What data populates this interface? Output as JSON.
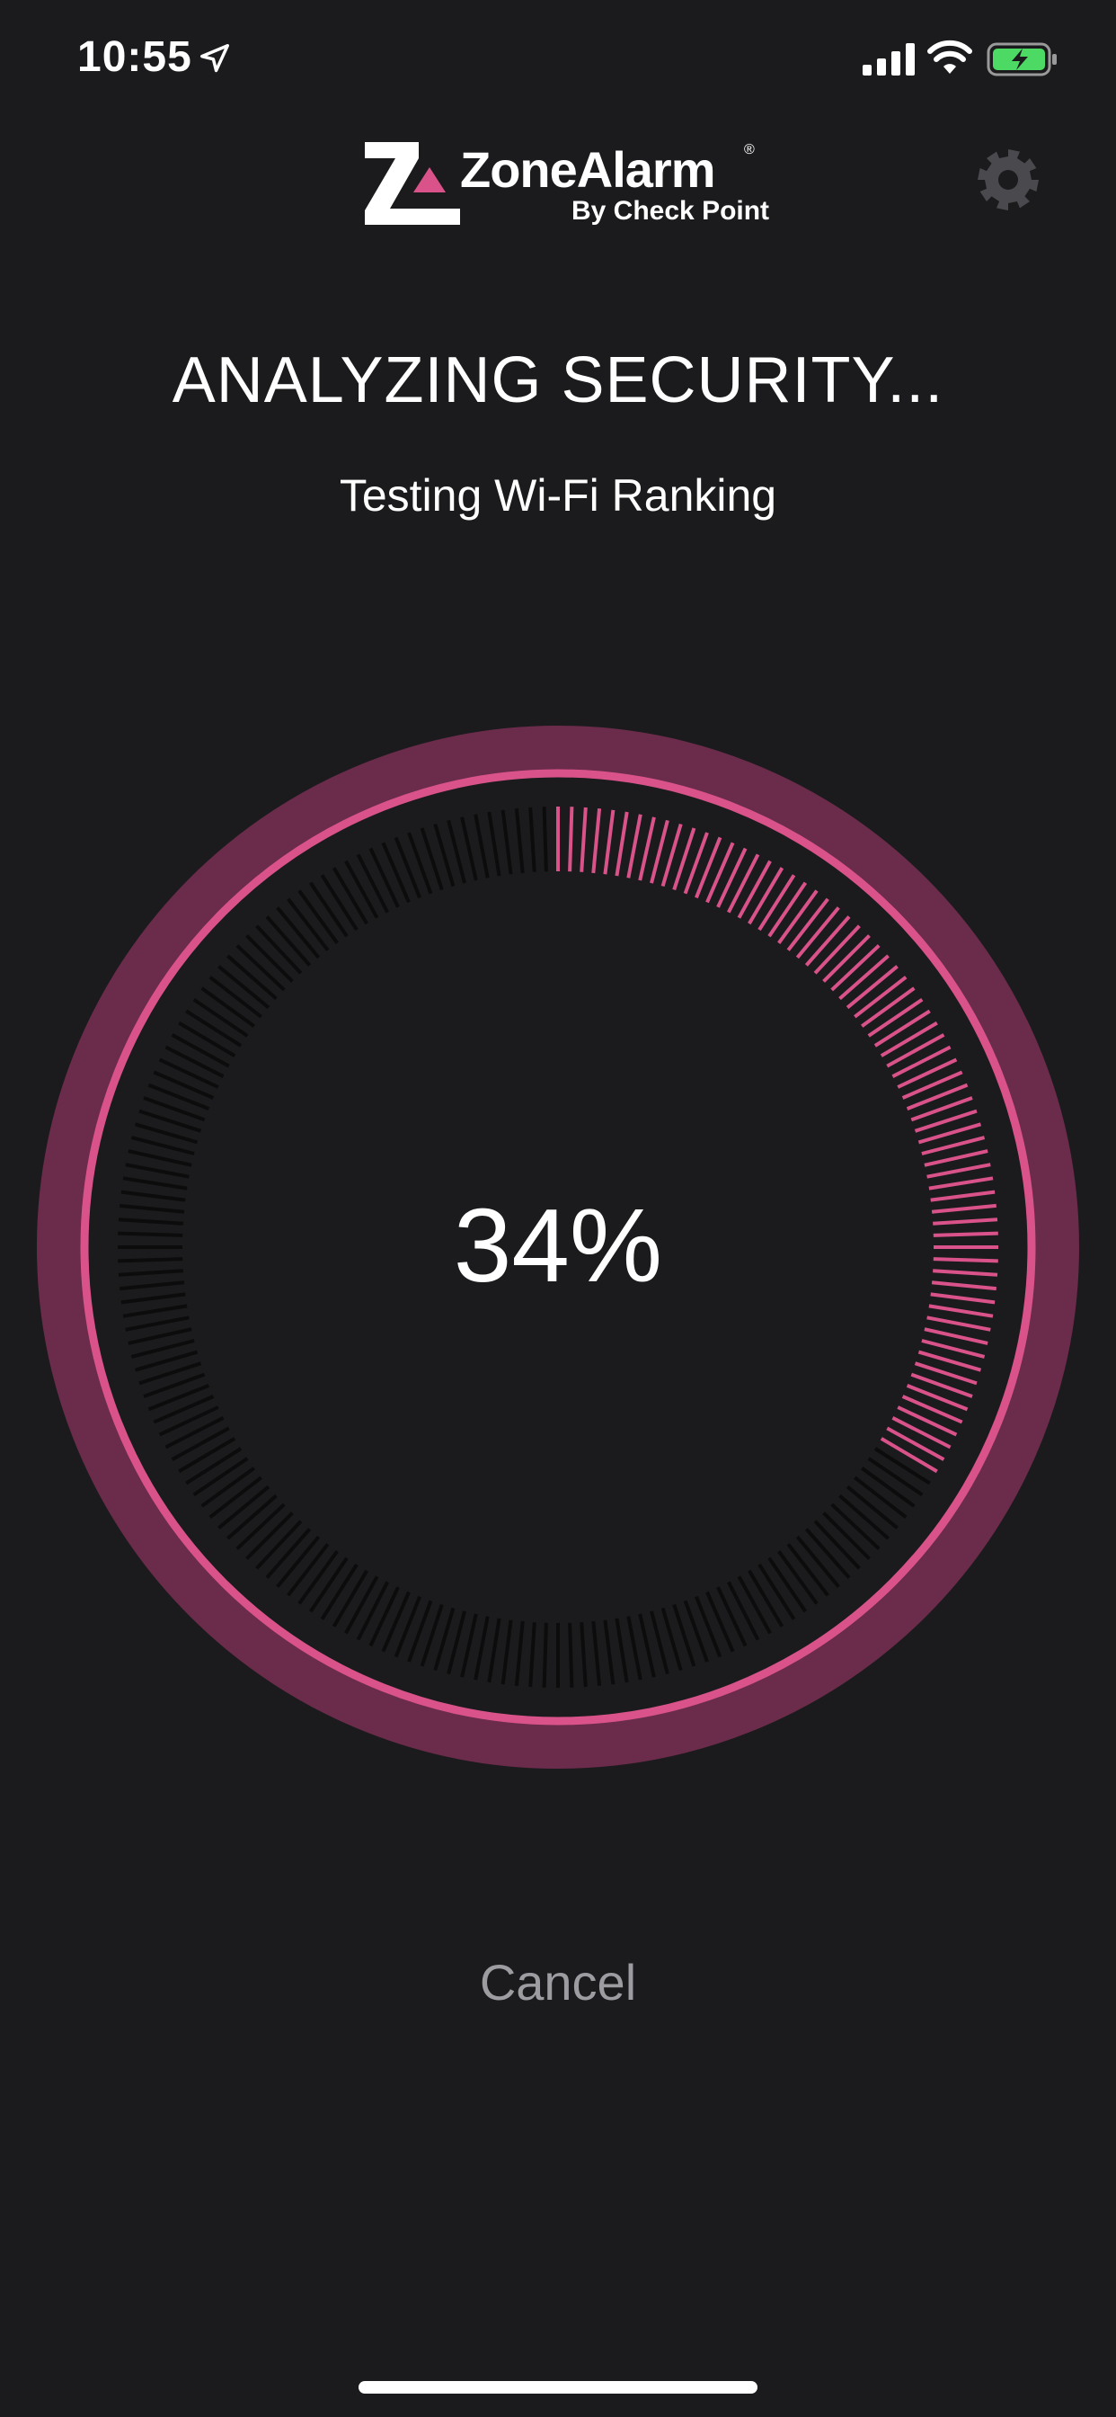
{
  "status_bar": {
    "time": "10:55",
    "icons": [
      "location-arrow-icon",
      "cellular-signal-icon",
      "wifi-icon",
      "battery-charging-icon"
    ],
    "battery_color": "#4cd964"
  },
  "header": {
    "logo_name": "ZoneAlarm",
    "logo_reg": "®",
    "logo_sub": "By Check Point",
    "settings_icon": "gear-icon"
  },
  "scan": {
    "title": "ANALYZING SECURITY...",
    "subtitle": "Testing Wi-Fi Ranking",
    "progress_label": "34%",
    "progress_fraction": 0.34,
    "accent_color": "#d9538a",
    "outer_ring_color": "#6b2b4b"
  },
  "actions": {
    "cancel_label": "Cancel"
  }
}
